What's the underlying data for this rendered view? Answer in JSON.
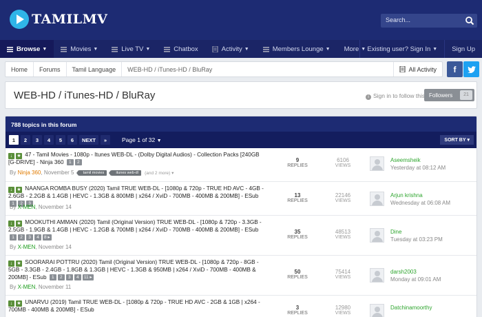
{
  "header": {
    "logo_text": "TAMILMV",
    "search_placeholder": "Search..."
  },
  "nav": {
    "items": [
      {
        "label": "Browse",
        "icon": "list-icon",
        "active": true
      },
      {
        "label": "Movies",
        "icon": "list-icon"
      },
      {
        "label": "Live TV",
        "icon": "list-icon"
      },
      {
        "label": "Chatbox",
        "icon": "list-icon"
      },
      {
        "label": "Activity",
        "icon": "document-icon"
      },
      {
        "label": "Members Lounge",
        "icon": "list-icon"
      },
      {
        "label": "More",
        "icon": ""
      }
    ],
    "signin": "Existing user? Sign In",
    "signup": "Sign Up"
  },
  "breadcrumb": {
    "items": [
      "Home",
      "Forums",
      "Tamil Language",
      "WEB-HD / iTunes-HD / BluRay"
    ],
    "all_activity": "All Activity"
  },
  "social": {
    "facebook": "f",
    "twitter": "twitter-bird"
  },
  "page": {
    "title": "WEB-HD / iTunes-HD / BluRay",
    "follow_text": "Sign in to follow this",
    "followers_label": "Followers",
    "followers_count": "21"
  },
  "list": {
    "count_label": "788 topics in this forum",
    "pages": [
      "1",
      "2",
      "3",
      "4",
      "5",
      "6"
    ],
    "next": "NEXT",
    "last": "»",
    "page_of": "Page 1 of 32",
    "sort": "SORT BY"
  },
  "topics": [
    {
      "title": "47 - Tamil Movies - 1080p - Itunes WEB-DL - (Dolby Digital Audios) - Collection Packs [240GB [G-DRIVE] - Ninja 360",
      "mini_pages": [
        "1",
        "2"
      ],
      "author": "Ninja 360",
      "author_color": "orange",
      "date": "November 5",
      "tags": [
        "tamil movies",
        "itunes web-dl"
      ],
      "tags_more": "(and 2 more)",
      "replies": "9",
      "views": "6106",
      "last_user": "Aseemsheik",
      "last_time": "Yesterday at 08:12 AM"
    },
    {
      "title": "NAANGA ROMBA BUSY (2020) Tamil TRUE WEB-DL - [1080p & 720p - TRUE HD AVC - 4GB - 2.6GB - 2.2GB & 1.4GB | HEVC - 1.3GB & 800MB | x264 / XviD - 700MB - 400MB & 200MB] - ESub",
      "mini_pages": [
        "1",
        "2",
        "3"
      ],
      "author": "X-MEN",
      "author_color": "green",
      "date": "November 14",
      "tags": [],
      "tags_more": "",
      "replies": "13",
      "views": "22146",
      "last_user": "Arjun krishna",
      "last_time": "Wednesday at 06:08 AM"
    },
    {
      "title": "MOOKUTHI AMMAN (2020) Tamil (Original Version) TRUE WEB-DL - [1080p & 720p - 3.3GB - 2.5GB - 1.9GB & 1.4GB | HEVC - 1.2GB & 700MB | x264 / XviD - 700MB - 400MB & 200MB] - ESub",
      "mini_pages": [
        "1",
        "2",
        "3",
        "4",
        "8"
      ],
      "author": "X-MEN",
      "author_color": "green",
      "date": "November 14",
      "tags": [],
      "tags_more": "",
      "replies": "35",
      "views": "48513",
      "last_user": "Dine",
      "last_time": "Tuesday at 03:23 PM"
    },
    {
      "title": "SOORARAI POTTRU (2020) Tamil (Original Version) TRUE WEB-DL - [1080p & 720p - 8GB - 5GB - 3.3GB - 2.4GB - 1.8GB & 1.3GB | HEVC - 1.3GB & 950MB | x264 / XviD - 700MB - 400MB & 200MB] - ESub",
      "mini_pages": [
        "1",
        "2",
        "3",
        "4",
        "11"
      ],
      "author": "X-MEN",
      "author_color": "green",
      "date": "November 11",
      "tags": [],
      "tags_more": "",
      "replies": "50",
      "views": "75414",
      "last_user": "darsh2003",
      "last_time": "Monday at 09:01 AM"
    },
    {
      "title": "UNARVU (2019) Tamil TRUE WEB-DL - [1080p & 720p - TRUE HD AVC - 2GB & 1GB | x264 - 700MB - 400MB & 200MB] - ESub",
      "mini_pages": [],
      "author": "",
      "author_color": "green",
      "date": "",
      "tags": [],
      "tags_more": "",
      "replies": "3",
      "views": "12980",
      "last_user": "Datchinamoorthy",
      "last_time": ""
    }
  ],
  "labels": {
    "by": "By",
    "replies": "REPLIES",
    "views": "VIEWS"
  },
  "colors": {
    "header": "#1d2b73",
    "nav": "#1b2566",
    "accent_green": "#2ea52e",
    "author_orange": "#e07b00"
  }
}
